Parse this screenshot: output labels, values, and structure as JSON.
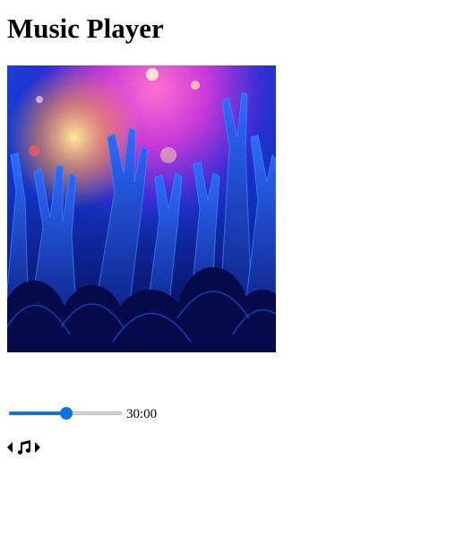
{
  "header": {
    "title": "Music Player"
  },
  "player": {
    "cover_image": "concert-crowd-hands",
    "progress_fraction": 0.51,
    "time_display": "30:00",
    "accent_color": "#0b75e4"
  },
  "controls": {
    "previous_icon": "caret-left-icon",
    "play_icon": "music-note-icon",
    "next_icon": "caret-right-icon"
  }
}
